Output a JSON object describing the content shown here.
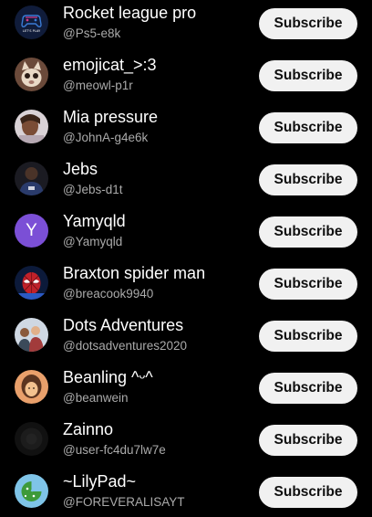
{
  "channels": [
    {
      "name": "Rocket league pro",
      "handle": "@Ps5-e8k",
      "subscribe_label": "Subscribe",
      "avatar_icon": "gamepad-lets-play-icon",
      "avatar_text": "LET'S PLAY",
      "avatar_colors": [
        "#101c3a",
        "#d23a8a",
        "#3a7bd5"
      ]
    },
    {
      "name": "emojicat_>:3",
      "handle": "@meowl-p1r",
      "subscribe_label": "Subscribe",
      "avatar_icon": "cat-photo-icon",
      "avatar_colors": [
        "#6b4a3a",
        "#e9d9c6",
        "#2a1c16"
      ]
    },
    {
      "name": "Mia pressure",
      "handle": "@JohnA-g4e6k",
      "subscribe_label": "Subscribe",
      "avatar_icon": "person-photo-icon",
      "avatar_colors": [
        "#d9d2d6",
        "#7a4c35",
        "#5b3a2a"
      ]
    },
    {
      "name": "Jebs",
      "handle": "@Jebs-d1t",
      "subscribe_label": "Subscribe",
      "avatar_icon": "person-photo-icon",
      "avatar_colors": [
        "#1b1b22",
        "#4a3328",
        "#2a3b6b"
      ]
    },
    {
      "name": "Yamyqld",
      "handle": "@Yamyqld",
      "subscribe_label": "Subscribe",
      "avatar_icon": "letter-avatar-icon",
      "avatar_letter": "Y",
      "avatar_colors": [
        "#7b4fd6"
      ]
    },
    {
      "name": "Braxton spider man",
      "handle": "@breacook9940",
      "subscribe_label": "Subscribe",
      "avatar_icon": "spider-man-icon",
      "avatar_colors": [
        "#0c1a3a",
        "#c0212a",
        "#2b59c3"
      ]
    },
    {
      "name": "Dots Adventures",
      "handle": "@dotsadventures2020",
      "subscribe_label": "Subscribe",
      "avatar_icon": "group-photo-icon",
      "avatar_colors": [
        "#cfd8e3",
        "#8a5a3c",
        "#3b4a5a"
      ]
    },
    {
      "name": "Beanling ^ᵕ^",
      "handle": "@beanwein",
      "subscribe_label": "Subscribe",
      "avatar_icon": "person-photo-icon",
      "avatar_colors": [
        "#e9a06b",
        "#5b3520",
        "#f3c28f"
      ]
    },
    {
      "name": "Zainno",
      "handle": "@user-fc4du7lw7e",
      "subscribe_label": "Subscribe",
      "avatar_icon": "dark-photo-icon",
      "avatar_colors": [
        "#111111",
        "#222222"
      ]
    },
    {
      "name": "~LilyPad~",
      "handle": "@FOREVERALISAYT",
      "subscribe_label": "Subscribe",
      "avatar_icon": "lily-pad-icon",
      "avatar_colors": [
        "#7fc4e8",
        "#3d9a3a",
        "#ffffff"
      ]
    }
  ]
}
